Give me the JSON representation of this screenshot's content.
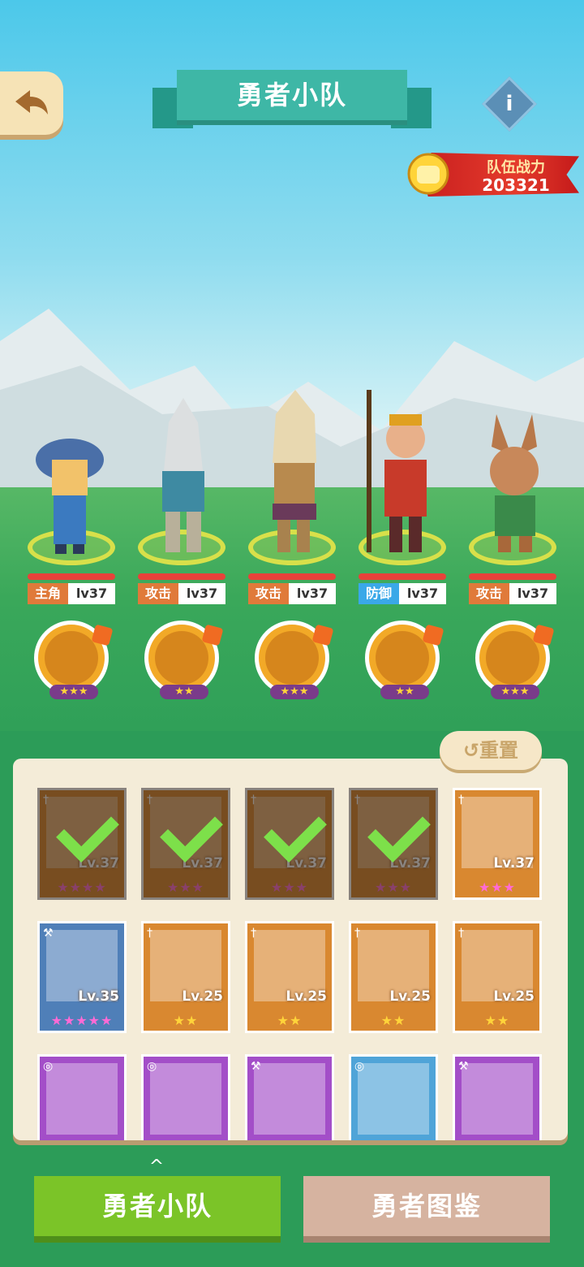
{
  "header": {
    "title": "勇者小队",
    "back_icon": "back-arrow-icon",
    "info_label": "i"
  },
  "team_power": {
    "label": "队伍战力",
    "value": "203321"
  },
  "heroes": [
    {
      "role": "主角",
      "level": "lv37",
      "role_color": "#e07a3a"
    },
    {
      "role": "攻击",
      "level": "lv37",
      "role_color": "#e07a3a"
    },
    {
      "role": "攻击",
      "level": "lv37",
      "role_color": "#e07a3a"
    },
    {
      "role": "防御",
      "level": "lv37",
      "role_color": "#3aa8e8"
    },
    {
      "role": "攻击",
      "level": "lv37",
      "role_color": "#e07a3a"
    }
  ],
  "pets": [
    {
      "stars": "★★★"
    },
    {
      "stars": "★★"
    },
    {
      "stars": "★★★"
    },
    {
      "stars": "★★"
    },
    {
      "stars": "★★★"
    }
  ],
  "reset_label": "↺重置",
  "roster": {
    "row1": [
      {
        "level": "Lv.37",
        "stars": "★★★★",
        "selected": true
      },
      {
        "level": "Lv.37",
        "stars": "★★★",
        "selected": true
      },
      {
        "level": "Lv.37",
        "stars": "★★★",
        "selected": true
      },
      {
        "level": "Lv.37",
        "stars": "★★★",
        "selected": true
      },
      {
        "level": "Lv.37",
        "stars": "★★★",
        "selected": false
      }
    ],
    "row2": [
      {
        "level": "Lv.35",
        "stars": "★★★★★"
      },
      {
        "level": "Lv.25",
        "stars": "★★"
      },
      {
        "level": "Lv.25",
        "stars": "★★"
      },
      {
        "level": "Lv.25",
        "stars": "★★"
      },
      {
        "level": "Lv.25",
        "stars": "★★"
      }
    ]
  },
  "tabs": {
    "active": "勇者小队",
    "inactive": "勇者图鉴",
    "caret": "^"
  }
}
